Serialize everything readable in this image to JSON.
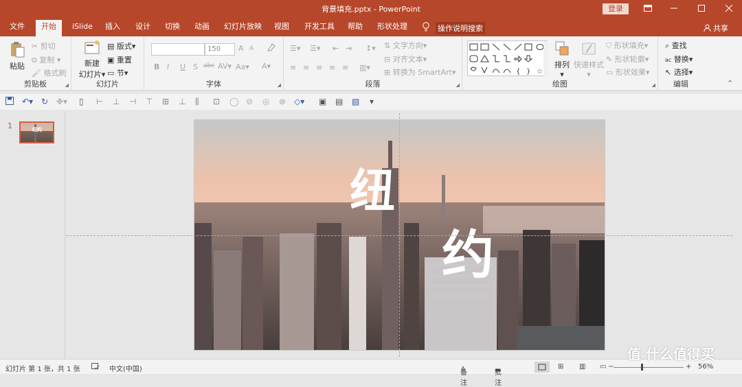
{
  "titlebar": {
    "title": "背景填充.pptx  -  PowerPoint",
    "login": "登录",
    "ribbon_display_icon": "ribbon-display-icon",
    "minimize_icon": "minimize-icon",
    "maximize_icon": "maximize-icon",
    "close_icon": "close-icon"
  },
  "tabs": [
    {
      "label": "文件"
    },
    {
      "label": "开始"
    },
    {
      "label": "iSlide"
    },
    {
      "label": "插入"
    },
    {
      "label": "设计"
    },
    {
      "label": "切换"
    },
    {
      "label": "动画"
    },
    {
      "label": "幻灯片放映"
    },
    {
      "label": "视图"
    },
    {
      "label": "开发工具"
    },
    {
      "label": "帮助"
    },
    {
      "label": "形状处理"
    }
  ],
  "tell_me": "操作说明搜索",
  "share": "共享",
  "ribbon": {
    "clipboard": {
      "label": "剪贴板",
      "paste": "粘贴",
      "cut": "剪切",
      "copy": "复制",
      "format_painter": "格式刷"
    },
    "slides": {
      "label": "幻灯片",
      "new_slide_line1": "新建",
      "new_slide_line2": "幻灯片",
      "layout": "版式",
      "reset": "重置",
      "section": "节"
    },
    "font": {
      "label": "字体",
      "font_name": "",
      "font_size": "150",
      "bold": "B",
      "italic": "I",
      "underline": "U",
      "strike": "S",
      "shadow": "abc",
      "spacing": "AV",
      "case": "Aa",
      "color": "A",
      "grow": "A",
      "shrink": "A"
    },
    "paragraph": {
      "label": "段落",
      "text_direction": "文字方向",
      "align_text": "对齐文本",
      "convert_smartart": "转换为 SmartArt"
    },
    "drawing": {
      "label": "绘图",
      "arrange": "排列",
      "quick_styles": "快速样式",
      "shape_fill": "形状填充",
      "shape_outline": "形状轮廓",
      "shape_effects": "形状效果"
    },
    "editing": {
      "label": "编辑",
      "find": "查找",
      "replace": "替换",
      "select": "选择"
    }
  },
  "slide": {
    "title_char1": "纽",
    "title_char2": "约",
    "thumb_text": "纽约",
    "slide_number": "1"
  },
  "statusbar": {
    "slide_info": "幻灯片 第 1 张，共 1 张",
    "language": "中文(中国)",
    "notes": "备注",
    "comments": "批注",
    "zoom": "56%",
    "watermark": "值 什么值得买"
  },
  "colors": {
    "brand": "#b7472a",
    "accent_light": "#f4d9d1"
  }
}
